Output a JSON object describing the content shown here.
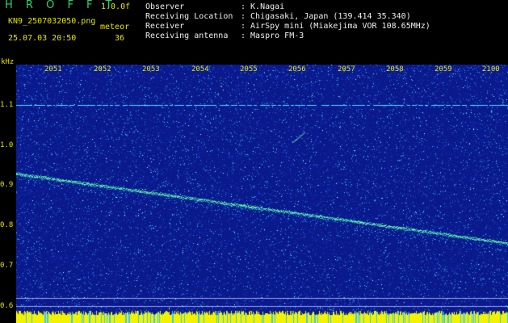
{
  "header": {
    "app_title": "H R O F F T",
    "version": "1.0.0f",
    "filename": "KN9_2507032050.png",
    "datetime": "25.07.03 20:50",
    "meteor_label": "meteor",
    "meteor_count": "36"
  },
  "metadata": [
    {
      "label": "Observer",
      "value": ": K.Nagai"
    },
    {
      "label": "Receiving Location",
      "value": ": Chigasaki, Japan (139.414 35.340)"
    },
    {
      "label": "Receiver",
      "value": ": AirSpy mini (Miakejima VOR 108.65MHz)"
    },
    {
      "label": "Receiving antenna",
      "value": ": Maspro FM-3"
    }
  ],
  "axis": {
    "unit": "kHz",
    "y_ticks": [
      "1.1",
      "1.0",
      "0.9",
      "0.8",
      "0.7",
      "0.6"
    ],
    "x_ticks": [
      "2051",
      "2052",
      "2053",
      "2054",
      "2055",
      "2056",
      "2057",
      "2058",
      "2059",
      "2100"
    ]
  },
  "colors": {
    "background": "#000000",
    "spectrogram_base": "#0a1a8c",
    "noise_bright": "#3ad6ff",
    "signal": "#7dff7a",
    "label": "#e6e600"
  }
}
